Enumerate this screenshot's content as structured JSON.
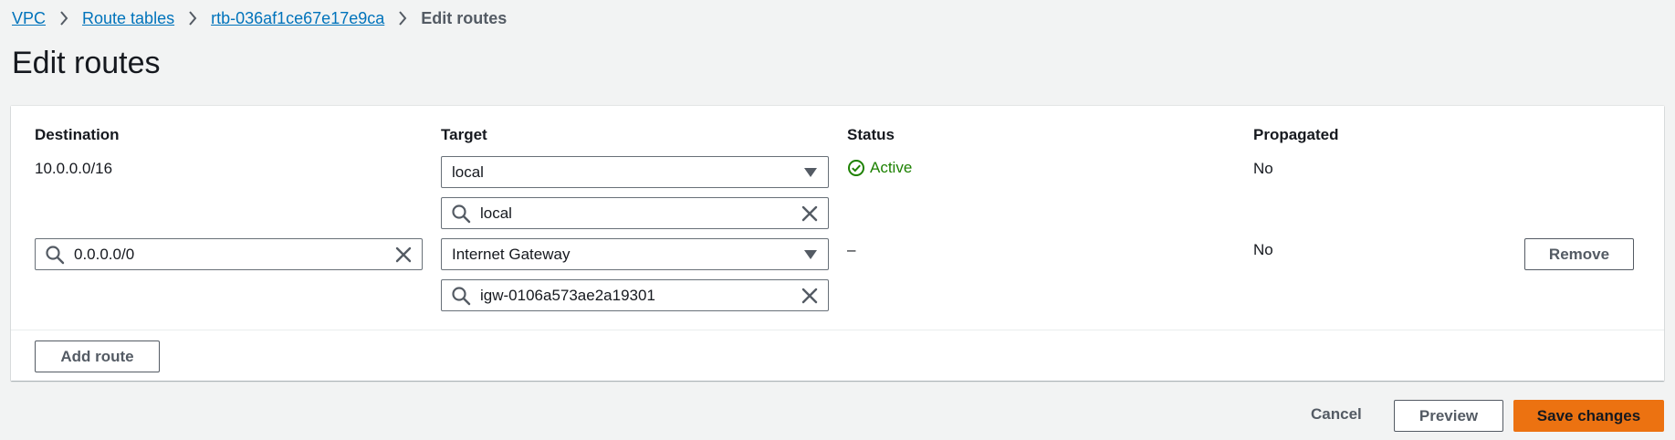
{
  "breadcrumb": {
    "items": [
      "VPC",
      "Route tables",
      "rtb-036af1ce67e17e9ca"
    ],
    "current": "Edit routes"
  },
  "page": {
    "title": "Edit routes"
  },
  "table": {
    "headers": {
      "destination": "Destination",
      "target": "Target",
      "status": "Status",
      "propagated": "Propagated"
    },
    "rows": [
      {
        "destination": "10.0.0.0/16",
        "target_type": "local",
        "target_value": "local",
        "status": "Active",
        "propagated": "No"
      },
      {
        "destination": "0.0.0.0/0",
        "target_type": "Internet Gateway",
        "target_value": "igw-0106a573ae2a19301",
        "status": "–",
        "propagated": "No",
        "remove_label": "Remove"
      }
    ]
  },
  "actions": {
    "add_route": "Add route",
    "cancel": "Cancel",
    "preview": "Preview",
    "save": "Save changes"
  },
  "icons": {
    "breadcrumb_separator": "chevron-right-icon",
    "search": "search-icon",
    "clear": "close-icon",
    "dropdown": "caret-down-icon",
    "status_active": "status-success-icon"
  },
  "colors": {
    "page_bg": "#f2f3f3",
    "link": "#0073bb",
    "success": "#1d8102",
    "primary_button": "#ec7211",
    "text": "#16191f",
    "secondary_text": "#545b64"
  }
}
